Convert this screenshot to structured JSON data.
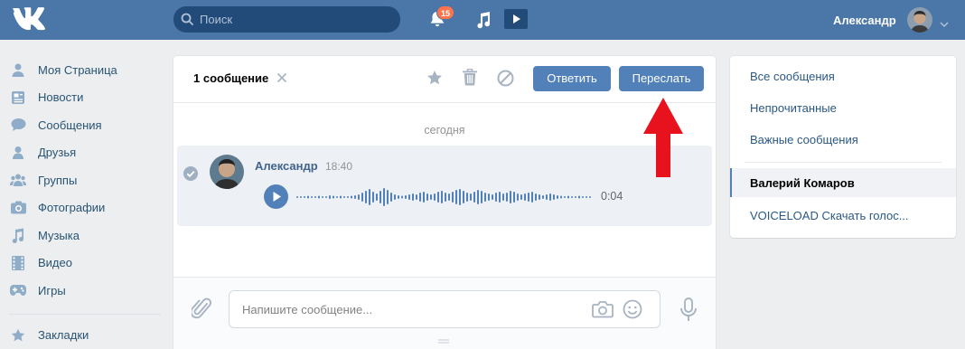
{
  "header": {
    "search_placeholder": "Поиск",
    "notifications_count": "15",
    "user_name": "Александр"
  },
  "nav": {
    "items": [
      {
        "label": "Моя Страница",
        "icon": "home-icon"
      },
      {
        "label": "Новости",
        "icon": "news-icon"
      },
      {
        "label": "Сообщения",
        "icon": "messages-icon"
      },
      {
        "label": "Друзья",
        "icon": "friends-icon"
      },
      {
        "label": "Группы",
        "icon": "groups-icon"
      },
      {
        "label": "Фотографии",
        "icon": "photos-icon"
      },
      {
        "label": "Музыка",
        "icon": "music-icon"
      },
      {
        "label": "Видео",
        "icon": "video-icon"
      },
      {
        "label": "Игры",
        "icon": "games-icon"
      }
    ],
    "bookmarks": {
      "label": "Закладки",
      "icon": "star-icon"
    }
  },
  "toolbar": {
    "selection_label": "1 сообщение",
    "reply_label": "Ответить",
    "forward_label": "Переслать"
  },
  "conversation": {
    "date_separator": "сегодня",
    "message": {
      "author": "Александр",
      "time": "18:40",
      "voice_duration": "0:04"
    }
  },
  "composer": {
    "placeholder": "Напишите сообщение..."
  },
  "right_panel": {
    "filters": [
      "Все сообщения",
      "Непрочитанные",
      "Важные сообщения"
    ],
    "dialogs": [
      {
        "name": "Валерий Комаров",
        "active": true
      },
      {
        "name": "VOICELOAD Скачать голос...",
        "active": false
      }
    ]
  },
  "colors": {
    "header": "#4a76a8",
    "accent": "#5181b8",
    "badge": "#ff734c",
    "annotation_arrow": "#e8111e"
  }
}
